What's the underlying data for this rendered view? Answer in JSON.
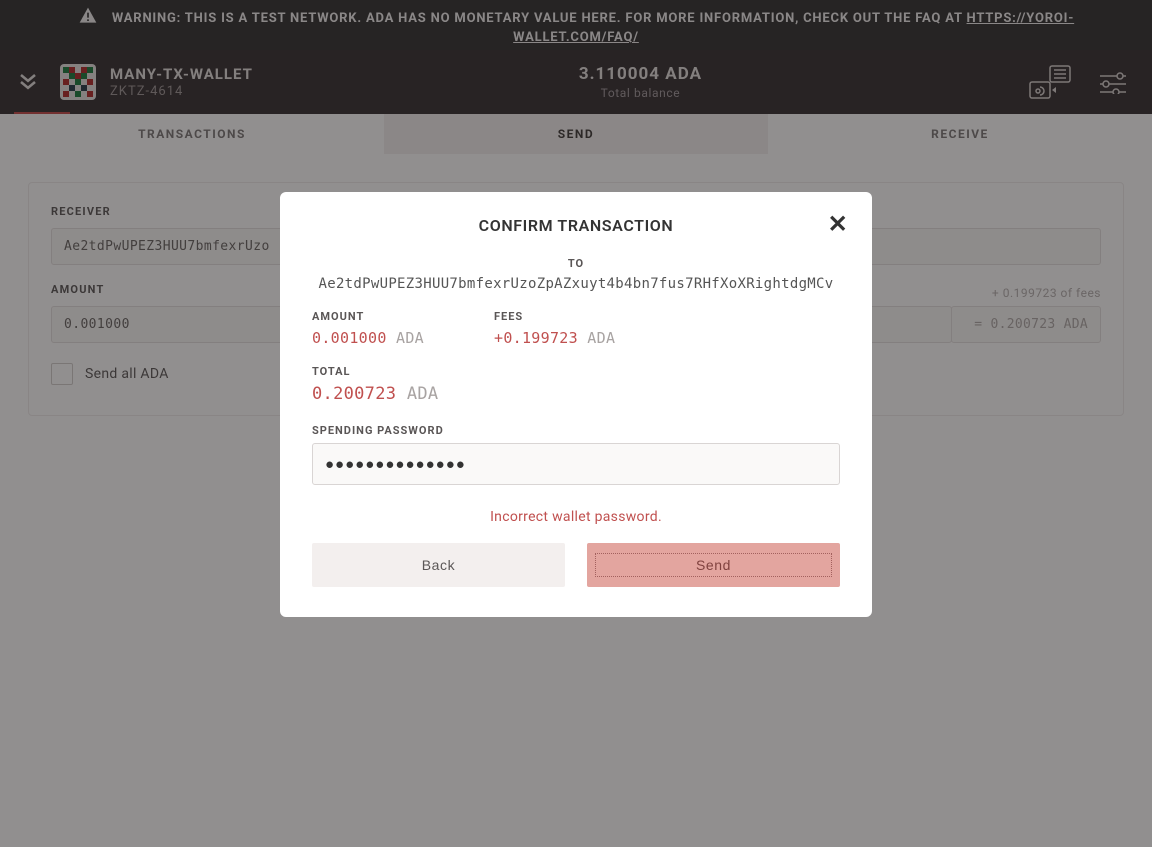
{
  "banner": {
    "text_before_link": "WARNING: THIS IS A TEST NETWORK. ADA HAS NO MONETARY VALUE HERE. FOR MORE INFORMATION, CHECK OUT THE FAQ AT ",
    "link_text": "HTTPS://YOROI-WALLET.COM/FAQ/"
  },
  "header": {
    "wallet_name": "MANY-TX-WALLET",
    "wallet_plate": "ZKTZ-4614",
    "balance": "3.110004 ADA",
    "balance_label": "Total balance"
  },
  "tabs": {
    "transactions": "TRANSACTIONS",
    "send": "SEND",
    "receive": "RECEIVE"
  },
  "form": {
    "receiver_label": "RECEIVER",
    "receiver_value": "Ae2tdPwUPEZ3HUU7bmfexrUzo",
    "amount_label": "AMOUNT",
    "amount_value": "0.001000",
    "fee_hint": "+ 0.199723 of fees",
    "total_hint": "= 0.200723 ADA",
    "send_all_label": "Send all ADA"
  },
  "dialog": {
    "title": "CONFIRM TRANSACTION",
    "to_label": "TO",
    "to_value": "Ae2tdPwUPEZ3HUU7bmfexrUzoZpAZxuyt4b4bn7fus7RHfXoXRightdgMCv",
    "amount_label": "AMOUNT",
    "amount_value": "0.001000",
    "amount_unit": " ADA",
    "fees_label": "FEES",
    "fees_value": "+0.199723",
    "fees_unit": " ADA",
    "total_label": "TOTAL",
    "total_value": "0.200723",
    "total_unit": " ADA",
    "password_label": "SPENDING PASSWORD",
    "password_value": "●●●●●●●●●●●●●●",
    "error_text": "Incorrect wallet password.",
    "back_label": "Back",
    "send_label": "Send"
  }
}
